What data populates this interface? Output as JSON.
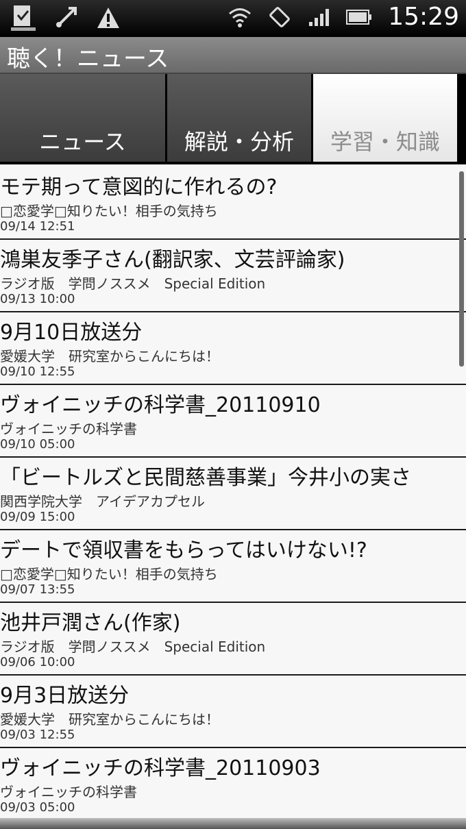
{
  "status_bar": {
    "icons_left": [
      "download-complete-icon",
      "usb-icon",
      "warning-icon"
    ],
    "icons_right": [
      "wifi-icon",
      "rotate-icon",
      "signal-icon",
      "battery-icon"
    ],
    "time": "15:29"
  },
  "app": {
    "title": "聴く！ニュース"
  },
  "tabs": [
    {
      "label": "ニュース",
      "selected": false
    },
    {
      "label": "解説・分析",
      "selected": false
    },
    {
      "label": "学習・知識",
      "selected": true
    }
  ],
  "items": [
    {
      "title": "モテ期って意図的に作れるの?",
      "source": "□恋愛学□知りたい！相手の気持ち",
      "date": "09/14 12:51"
    },
    {
      "title": "鴻巣友季子さん(翻訳家、文芸評論家)",
      "source": "ラジオ版　学問ノススメ　Special Edition",
      "date": "09/13 10:00"
    },
    {
      "title": "9月10日放送分",
      "source": "愛媛大学　研究室からこんにちは！",
      "date": "09/10 12:55"
    },
    {
      "title": "ヴォイニッチの科学書_20110910",
      "source": "ヴォイニッチの科学書",
      "date": "09/10 05:00"
    },
    {
      "title": "「ビートルズと民間慈善事業」今井小の実さ",
      "source": "関西学院大学　アイデアカプセル",
      "date": "09/09 15:00"
    },
    {
      "title": "デートで領収書をもらってはいけない!?",
      "source": "□恋愛学□知りたい！相手の気持ち",
      "date": "09/07 13:55"
    },
    {
      "title": "池井戸潤さん(作家)",
      "source": "ラジオ版　学問ノススメ　Special Edition",
      "date": "09/06 10:00"
    },
    {
      "title": "9月3日放送分",
      "source": "愛媛大学　研究室からこんにちは！",
      "date": "09/03 12:55"
    },
    {
      "title": "ヴォイニッチの科学書_20110903",
      "source": "ヴォイニッチの科学書",
      "date": "09/03 05:00"
    }
  ]
}
